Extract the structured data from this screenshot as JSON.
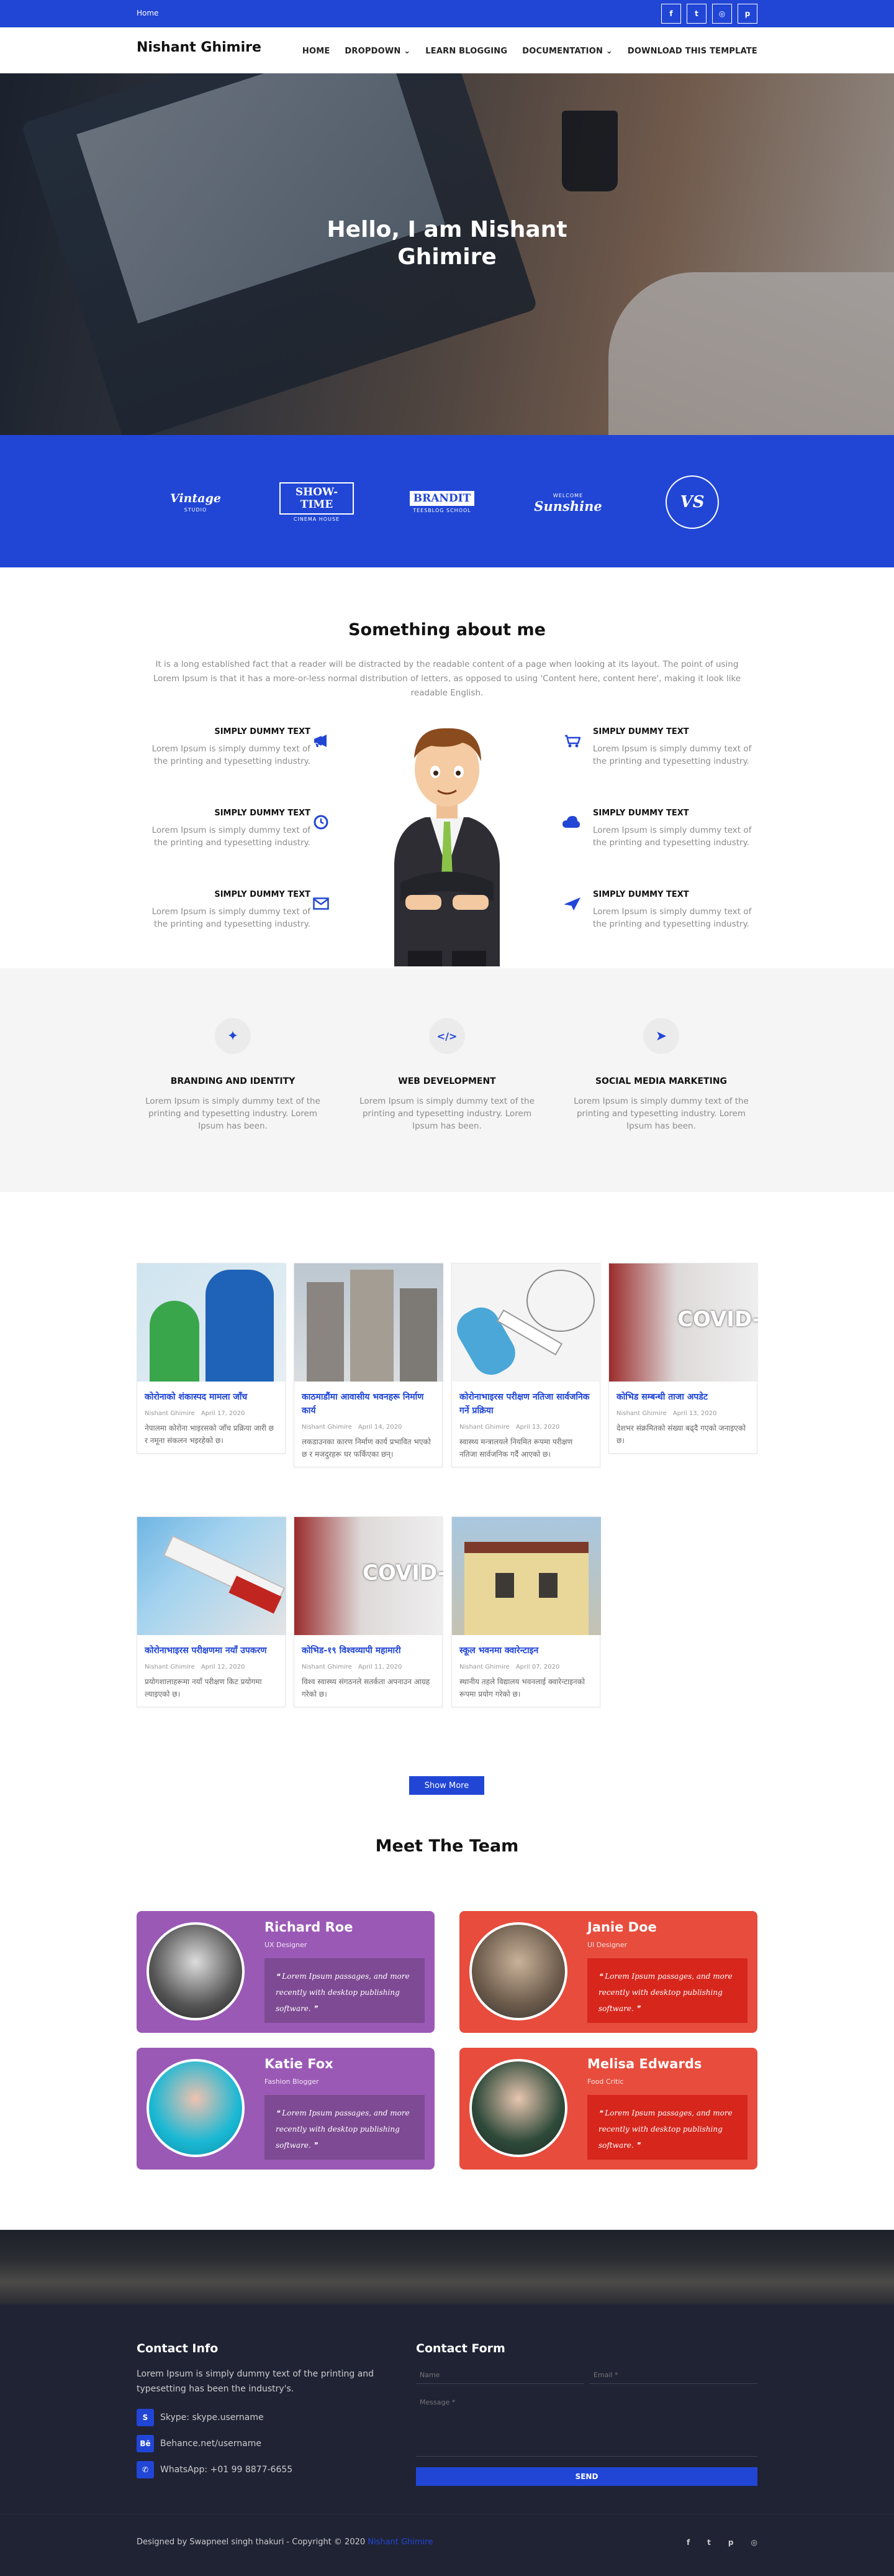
{
  "topbar": {
    "home": "Home",
    "socials": [
      {
        "icon": "facebook-icon",
        "glyph": "f"
      },
      {
        "icon": "twitter-icon",
        "glyph": "t"
      },
      {
        "icon": "instagram-icon",
        "glyph": "◎"
      },
      {
        "icon": "pinterest-icon",
        "glyph": "p"
      }
    ]
  },
  "nav": {
    "brand": "Nishant Ghimire",
    "items": [
      "HOME",
      "DROPDOWN ⌄",
      "LEARN BLOGGING",
      "DOCUMENTATION ⌄",
      "DOWNLOAD THIS TEMPLATE"
    ]
  },
  "hero": {
    "line1": "Hello, I am Nishant",
    "line2": "Ghimire"
  },
  "brands": [
    {
      "main": "Vintage",
      "sub": "STUDIO"
    },
    {
      "main": "SHOW-TIME",
      "sub": "CINEMA HOUSE"
    },
    {
      "main": "BRANDIT",
      "sub": "TEESBLOG SCHOOL"
    },
    {
      "main": "Sunshine",
      "sub": "WELCOME"
    },
    {
      "main": "VS",
      "sub": ""
    }
  ],
  "about": {
    "title": "Something about me",
    "text": "It is a long established fact that a reader will be distracted by the readable content of a page when looking at its layout. The point of using Lorem Ipsum is that it has a more-or-less normal distribution of letters, as opposed to using 'Content here, content here', making it look like readable English.",
    "features_left": [
      {
        "title": "SIMPLY DUMMY TEXT",
        "text": "Lorem Ipsum is simply dummy text of the printing and typesetting industry.",
        "icon": "megaphone-icon",
        "glyph": "📢"
      },
      {
        "title": "SIMPLY DUMMY TEXT",
        "text": "Lorem Ipsum is simply dummy text of the printing and typesetting industry.",
        "icon": "clock-icon",
        "glyph": "◷"
      },
      {
        "title": "SIMPLY DUMMY TEXT",
        "text": "Lorem Ipsum is simply dummy text of the printing and typesetting industry.",
        "icon": "envelope-icon",
        "glyph": "✉"
      }
    ],
    "features_right": [
      {
        "title": "SIMPLY DUMMY TEXT",
        "text": "Lorem Ipsum is simply dummy text of the printing and typesetting industry.",
        "icon": "truck-icon",
        "glyph": "⛟"
      },
      {
        "title": "SIMPLY DUMMY TEXT",
        "text": "Lorem Ipsum is simply dummy text of the printing and typesetting industry.",
        "icon": "cloud-icon",
        "glyph": "☁"
      },
      {
        "title": "SIMPLY DUMMY TEXT",
        "text": "Lorem Ipsum is simply dummy text of the printing and typesetting industry.",
        "icon": "plane-icon",
        "glyph": "✈"
      }
    ]
  },
  "services": [
    {
      "title": "BRANDING AND IDENTITY",
      "text": "Lorem Ipsum is simply dummy text of the printing and typesetting industry. Lorem Ipsum has been.",
      "icon": "magic-wand-icon",
      "glyph": "✦"
    },
    {
      "title": "WEB DEVELOPMENT",
      "text": "Lorem Ipsum is simply dummy text of the printing and typesetting industry. Lorem Ipsum has been.",
      "icon": "code-icon",
      "glyph": "</>"
    },
    {
      "title": "SOCIAL MEDIA MARKETING",
      "text": "Lorem Ipsum is simply dummy text of the printing and typesetting industry. Lorem Ipsum has been.",
      "icon": "paper-plane-icon",
      "glyph": "➤"
    }
  ],
  "posts": [
    {
      "title": "कोरोनाको शंकास्पद मामला जाँच",
      "author": "Nishant Ghimire",
      "date": "April 17, 2020",
      "excerpt": "नेपालमा कोरोना भाइरसको जाँच प्रक्रिया जारी छ र नमूना संकलन भइरहेको छ।"
    },
    {
      "title": "काठमाडौंमा आवासीय भवनहरू निर्माण कार्य",
      "author": "Nishant Ghimire",
      "date": "April 14, 2020",
      "excerpt": "लकडाउनका कारण निर्माण कार्य प्रभावित भएको छ र मजदुरहरू घर फर्किएका छन्।"
    },
    {
      "title": "कोरोनाभाइरस परीक्षण नतिजा सार्वजनिक गर्ने प्रक्रिया",
      "author": "Nishant Ghimire",
      "date": "April 13, 2020",
      "excerpt": "स्वास्थ्य मन्त्रालयले नियमित रूपमा परीक्षण नतिजा सार्वजनिक गर्दै आएको छ।"
    },
    {
      "title": "कोभिड सम्बन्धी ताजा अपडेट",
      "author": "Nishant Ghimire",
      "date": "April 13, 2020",
      "excerpt": "देशभर संक्रमितको संख्या बढ्दै गएको जनाइएको छ।"
    },
    {
      "title": "कोरोनाभाइरस परीक्षणमा नयाँ उपकरण",
      "author": "Nishant Ghimire",
      "date": "April 12, 2020",
      "excerpt": "प्रयोगशालाहरूमा नयाँ परीक्षण किट प्रयोगमा ल्याइएको छ।"
    },
    {
      "title": "कोभिड-१९ विश्वव्यापी महामारी",
      "author": "Nishant Ghimire",
      "date": "April 11, 2020",
      "excerpt": "विश्व स्वास्थ्य संगठनले सतर्कता अपनाउन आग्रह गरेको छ।"
    },
    {
      "title": "स्कूल भवनमा क्वारेन्टाइन",
      "author": "Nishant Ghimire",
      "date": "April 07, 2020",
      "excerpt": "स्थानीय तहले विद्यालय भवनलाई क्वारेन्टाइनको रूपमा प्रयोग गरेको छ।"
    }
  ],
  "show_more": "Show More",
  "team": {
    "title": "Meet The Team",
    "members": [
      {
        "name": "Richard Roe",
        "role": "UX Designer",
        "quote": "Lorem Ipsum passages, and more recently with desktop publishing software."
      },
      {
        "name": "Janie Doe",
        "role": "UI Designer",
        "quote": "Lorem Ipsum passages, and more recently with desktop publishing software."
      },
      {
        "name": "Katie Fox",
        "role": "Fashion Blogger",
        "quote": "Lorem Ipsum passages, and more recently with desktop publishing software."
      },
      {
        "name": "Melisa Edwards",
        "role": "Food Critic",
        "quote": "Lorem Ipsum passages, and more recently with desktop publishing software."
      }
    ]
  },
  "footer": {
    "contact_title": "Contact Info",
    "contact_text": "Lorem Ipsum is simply dummy text of the printing and typesetting has been the industry's.",
    "skype": "Skype: skype.username",
    "behance": "Behance.net/username",
    "whatsapp": "WhatsApp: +01 99 8877-6655",
    "form_title": "Contact Form",
    "name_placeholder": "Name",
    "email_placeholder": "Email *",
    "message_placeholder": "Message *",
    "send": "SEND",
    "copyright": "Designed by Swapneel singh thakuri - Copyright © 2020",
    "copyright_link": "Nishant Ghimire"
  }
}
